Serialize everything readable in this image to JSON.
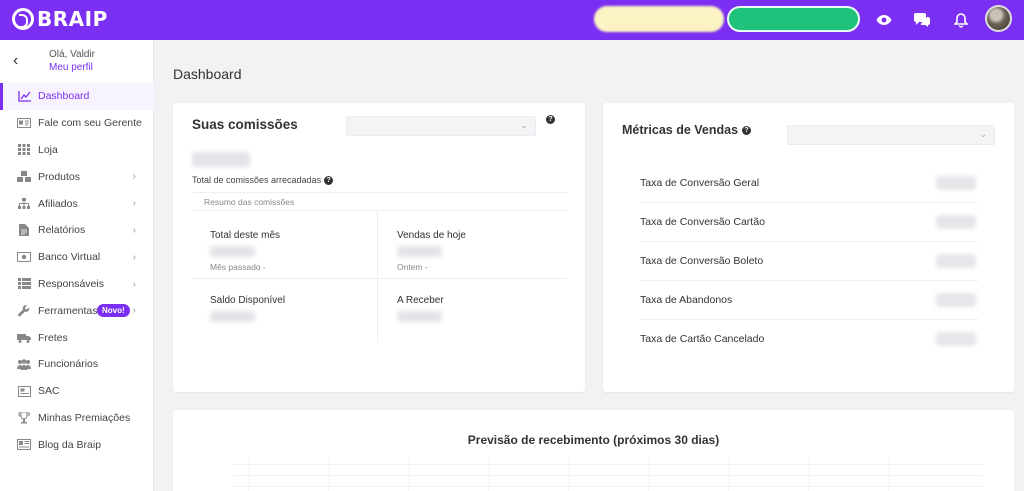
{
  "brand": {
    "name": "BRAIP",
    "accent": "#7b2ff2"
  },
  "topbar": {
    "icons": [
      "eye-icon",
      "chat-icon",
      "bell-icon"
    ]
  },
  "profile": {
    "greeting": "Olá, Valdir",
    "link": "Meu perfil"
  },
  "sidebar": {
    "items": [
      {
        "label": "Dashboard",
        "icon": "chart-line-icon",
        "active": true
      },
      {
        "label": "Fale com seu Gerente",
        "icon": "id-card-icon"
      },
      {
        "label": "Loja",
        "icon": "grid-icon"
      },
      {
        "label": "Produtos",
        "icon": "cubes-icon",
        "chevron": true
      },
      {
        "label": "Afiliados",
        "icon": "sitemap-icon",
        "chevron": true
      },
      {
        "label": "Relatórios",
        "icon": "file-icon",
        "chevron": true
      },
      {
        "label": "Banco Virtual",
        "icon": "money-icon",
        "chevron": true
      },
      {
        "label": "Responsáveis",
        "icon": "list-icon",
        "chevron": true
      },
      {
        "label": "Ferramentas",
        "icon": "wrench-icon",
        "chevron": true,
        "badge": "Novo!"
      },
      {
        "label": "Fretes",
        "icon": "truck-icon"
      },
      {
        "label": "Funcionários",
        "icon": "users-icon"
      },
      {
        "label": "SAC",
        "icon": "sac-icon"
      },
      {
        "label": "Minhas Premiações",
        "icon": "trophy-icon"
      },
      {
        "label": "Blog da Braip",
        "icon": "newspaper-icon"
      }
    ]
  },
  "page": {
    "title": "Dashboard"
  },
  "commissions": {
    "title": "Suas comissões",
    "total_label": "Total de comissões arrecadadas",
    "summary_label": "Resumo das comissões",
    "month_label": "Total deste mês",
    "month_sub": "Mês passado -",
    "today_label": "Vendas de hoje",
    "today_sub": "Ontem -",
    "available_label": "Saldo Disponível",
    "receivable_label": "A Receber"
  },
  "metrics": {
    "title": "Métricas de Vendas",
    "rows": [
      {
        "label": "Taxa de Conversão Geral"
      },
      {
        "label": "Taxa de Conversão Cartão"
      },
      {
        "label": "Taxa de Conversão Boleto"
      },
      {
        "label": "Taxa de Abandonos"
      },
      {
        "label": "Taxa de Cartão Cancelado"
      }
    ]
  },
  "forecast": {
    "title": "Previsão de recebimento (próximos 30 dias)"
  }
}
